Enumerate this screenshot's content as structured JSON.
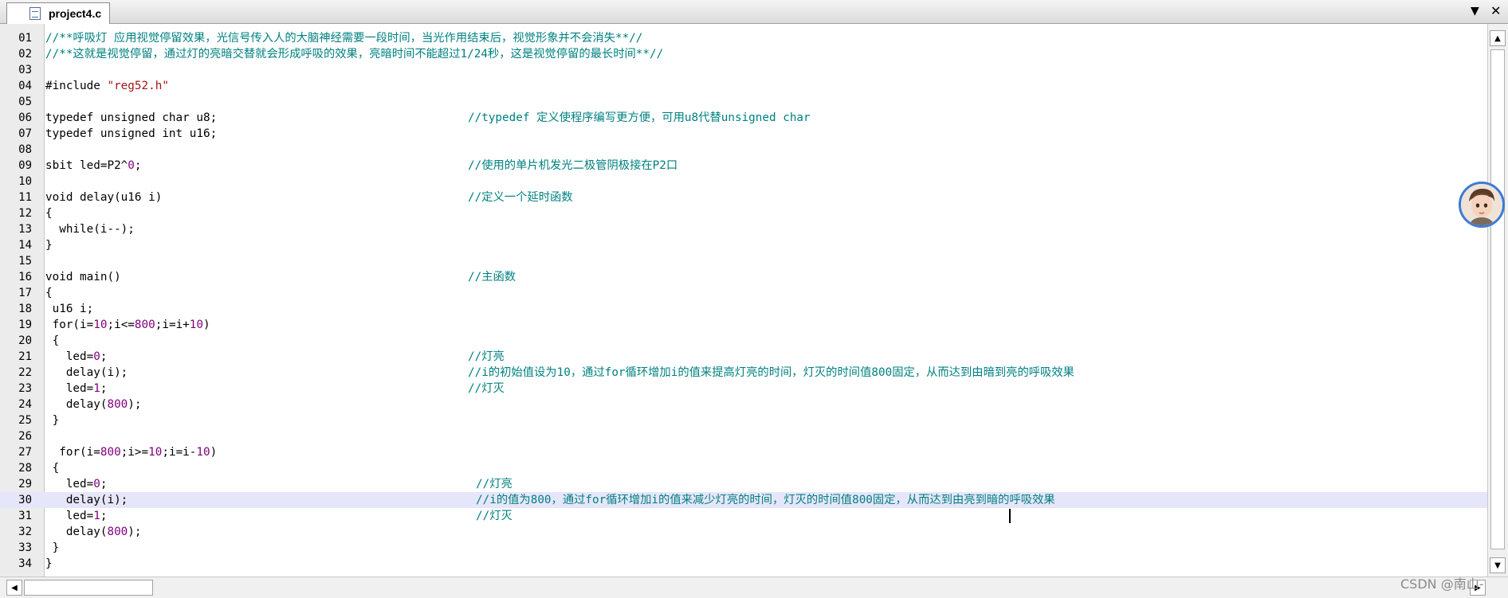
{
  "tab": {
    "title": "project4.c",
    "icons": [
      "file-icon",
      "chevron-down-icon",
      "close-icon"
    ]
  },
  "editor": {
    "current_line": 30,
    "lines": [
      {
        "n": "01",
        "code": [
          {
            "t": "//**呼吸灯 应用视觉停留效果，光信号传入人的大脑神经需要一段时间，当光作用结束后，视觉形象并不会消失**//",
            "c": "com"
          }
        ],
        "comment": ""
      },
      {
        "n": "02",
        "code": [
          {
            "t": "//**这就是视觉停留，通过灯的亮暗交替就会形成呼吸的效果，亮暗时间不能超过1/24秒，这是视觉停留的最长时间**//",
            "c": "com"
          }
        ],
        "comment": ""
      },
      {
        "n": "03",
        "code": [],
        "comment": ""
      },
      {
        "n": "04",
        "code": [
          {
            "t": "#include ",
            "c": "kw"
          },
          {
            "t": "\"reg52.h\"",
            "c": "str"
          }
        ],
        "comment": ""
      },
      {
        "n": "05",
        "code": [],
        "comment": ""
      },
      {
        "n": "06",
        "code": [
          {
            "t": "typedef unsigned char u8;",
            "c": "kw"
          }
        ],
        "comment": "//typedef 定义使程序编写更方便，可用u8代替unsigned char"
      },
      {
        "n": "07",
        "code": [
          {
            "t": "typedef unsigned int u16;",
            "c": "kw"
          }
        ],
        "comment": ""
      },
      {
        "n": "08",
        "code": [],
        "comment": ""
      },
      {
        "n": "09",
        "code": [
          {
            "t": "sbit led=P2^",
            "c": "kw"
          },
          {
            "t": "0",
            "c": "num"
          },
          {
            "t": ";",
            "c": "kw"
          }
        ],
        "comment": "//使用的单片机发光二极管阴极接在P2口"
      },
      {
        "n": "10",
        "code": [],
        "comment": ""
      },
      {
        "n": "11",
        "code": [
          {
            "t": "void delay(u16 i)",
            "c": "kw"
          }
        ],
        "comment": "//定义一个延时函数"
      },
      {
        "n": "12",
        "code": [
          {
            "t": "{",
            "c": "kw"
          }
        ],
        "comment": ""
      },
      {
        "n": "13",
        "code": [
          {
            "t": "  while(i--);",
            "c": "kw"
          }
        ],
        "comment": ""
      },
      {
        "n": "14",
        "code": [
          {
            "t": "}",
            "c": "kw"
          }
        ],
        "comment": ""
      },
      {
        "n": "15",
        "code": [],
        "comment": ""
      },
      {
        "n": "16",
        "code": [
          {
            "t": "void main()",
            "c": "kw"
          }
        ],
        "comment": "//主函数"
      },
      {
        "n": "17",
        "code": [
          {
            "t": "{",
            "c": "kw"
          }
        ],
        "comment": ""
      },
      {
        "n": "18",
        "code": [
          {
            "t": " u16 i;",
            "c": "kw"
          }
        ],
        "comment": ""
      },
      {
        "n": "19",
        "code": [
          {
            "t": " for(i=",
            "c": "kw"
          },
          {
            "t": "10",
            "c": "num"
          },
          {
            "t": ";i<=",
            "c": "kw"
          },
          {
            "t": "800",
            "c": "num"
          },
          {
            "t": ";i=i+",
            "c": "kw"
          },
          {
            "t": "10",
            "c": "num"
          },
          {
            "t": ")",
            "c": "kw"
          }
        ],
        "comment": ""
      },
      {
        "n": "20",
        "code": [
          {
            "t": " {",
            "c": "kw"
          }
        ],
        "comment": ""
      },
      {
        "n": "21",
        "code": [
          {
            "t": "   led=",
            "c": "kw"
          },
          {
            "t": "0",
            "c": "num"
          },
          {
            "t": ";",
            "c": "kw"
          }
        ],
        "comment": "//灯亮"
      },
      {
        "n": "22",
        "code": [
          {
            "t": "   delay(i);",
            "c": "kw"
          }
        ],
        "comment": "//i的初始值设为10，通过for循环增加i的值来提高灯亮的时间，灯灭的时间值800固定，从而达到由暗到亮的呼吸效果"
      },
      {
        "n": "23",
        "code": [
          {
            "t": "   led=",
            "c": "kw"
          },
          {
            "t": "1",
            "c": "num"
          },
          {
            "t": ";",
            "c": "kw"
          }
        ],
        "comment": "//灯灭"
      },
      {
        "n": "24",
        "code": [
          {
            "t": "   delay(",
            "c": "kw"
          },
          {
            "t": "800",
            "c": "num"
          },
          {
            "t": ");",
            "c": "kw"
          }
        ],
        "comment": ""
      },
      {
        "n": "25",
        "code": [
          {
            "t": " }",
            "c": "kw"
          }
        ],
        "comment": ""
      },
      {
        "n": "26",
        "code": [],
        "comment": ""
      },
      {
        "n": "27",
        "code": [
          {
            "t": "  for(i=",
            "c": "kw"
          },
          {
            "t": "800",
            "c": "num"
          },
          {
            "t": ";i>=",
            "c": "kw"
          },
          {
            "t": "10",
            "c": "num"
          },
          {
            "t": ";i=i-",
            "c": "kw"
          },
          {
            "t": "10",
            "c": "num"
          },
          {
            "t": ")",
            "c": "kw"
          }
        ],
        "comment": ""
      },
      {
        "n": "28",
        "code": [
          {
            "t": " {",
            "c": "kw"
          }
        ],
        "comment": ""
      },
      {
        "n": "29",
        "code": [
          {
            "t": "   led=",
            "c": "kw"
          },
          {
            "t": "0",
            "c": "num"
          },
          {
            "t": ";",
            "c": "kw"
          }
        ],
        "comment": "//灯亮",
        "shift": true
      },
      {
        "n": "30",
        "code": [
          {
            "t": "   delay(i);",
            "c": "kw"
          }
        ],
        "comment": "//i的值为800，通过for循环增加i的值来减少灯亮的时间，灯灭的时间值800固定，从而达到由亮到暗的呼吸效果",
        "shift": true
      },
      {
        "n": "31",
        "code": [
          {
            "t": "   led=",
            "c": "kw"
          },
          {
            "t": "1",
            "c": "num"
          },
          {
            "t": ";",
            "c": "kw"
          }
        ],
        "comment": "//灯灭",
        "shift": true
      },
      {
        "n": "32",
        "code": [
          {
            "t": "   delay(",
            "c": "kw"
          },
          {
            "t": "800",
            "c": "num"
          },
          {
            "t": ");",
            "c": "kw"
          }
        ],
        "comment": ""
      },
      {
        "n": "33",
        "code": [
          {
            "t": " }",
            "c": "kw"
          }
        ],
        "comment": ""
      },
      {
        "n": "34",
        "code": [
          {
            "t": "}",
            "c": "kw"
          }
        ],
        "comment": ""
      }
    ]
  },
  "watermark": "CSDN @南山-",
  "colors": {
    "comment": "#008080",
    "number": "#800080",
    "string": "#a31515",
    "current_line": "#e6e6fa"
  }
}
